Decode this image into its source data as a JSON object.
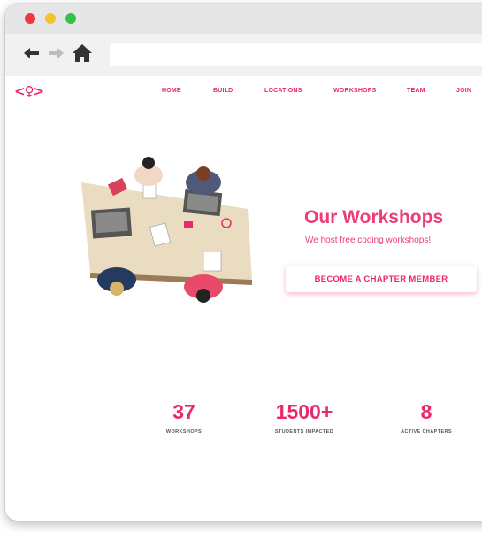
{
  "nav": {
    "logo": "<♀>",
    "items": [
      "HOME",
      "BUILD",
      "LOCATIONS",
      "WORKSHOPS",
      "TEAM",
      "JOIN"
    ]
  },
  "hero": {
    "title": "Our Workshops",
    "subtitle": "We host free coding workshops!",
    "cta_label": "BECOME A CHAPTER MEMBER"
  },
  "stats": [
    {
      "value": "37",
      "label": "WORKSHOPS"
    },
    {
      "value": "1500+",
      "label": "STUDENTS IMPACTED"
    },
    {
      "value": "8",
      "label": "ACTIVE CHAPTERS"
    }
  ],
  "colors": {
    "brand": "#e9286f",
    "traffic_red": "#f2353f",
    "traffic_yellow": "#f6c32b",
    "traffic_green": "#33c148"
  },
  "icons": [
    "back-arrow-icon",
    "forward-arrow-icon",
    "home-icon"
  ]
}
